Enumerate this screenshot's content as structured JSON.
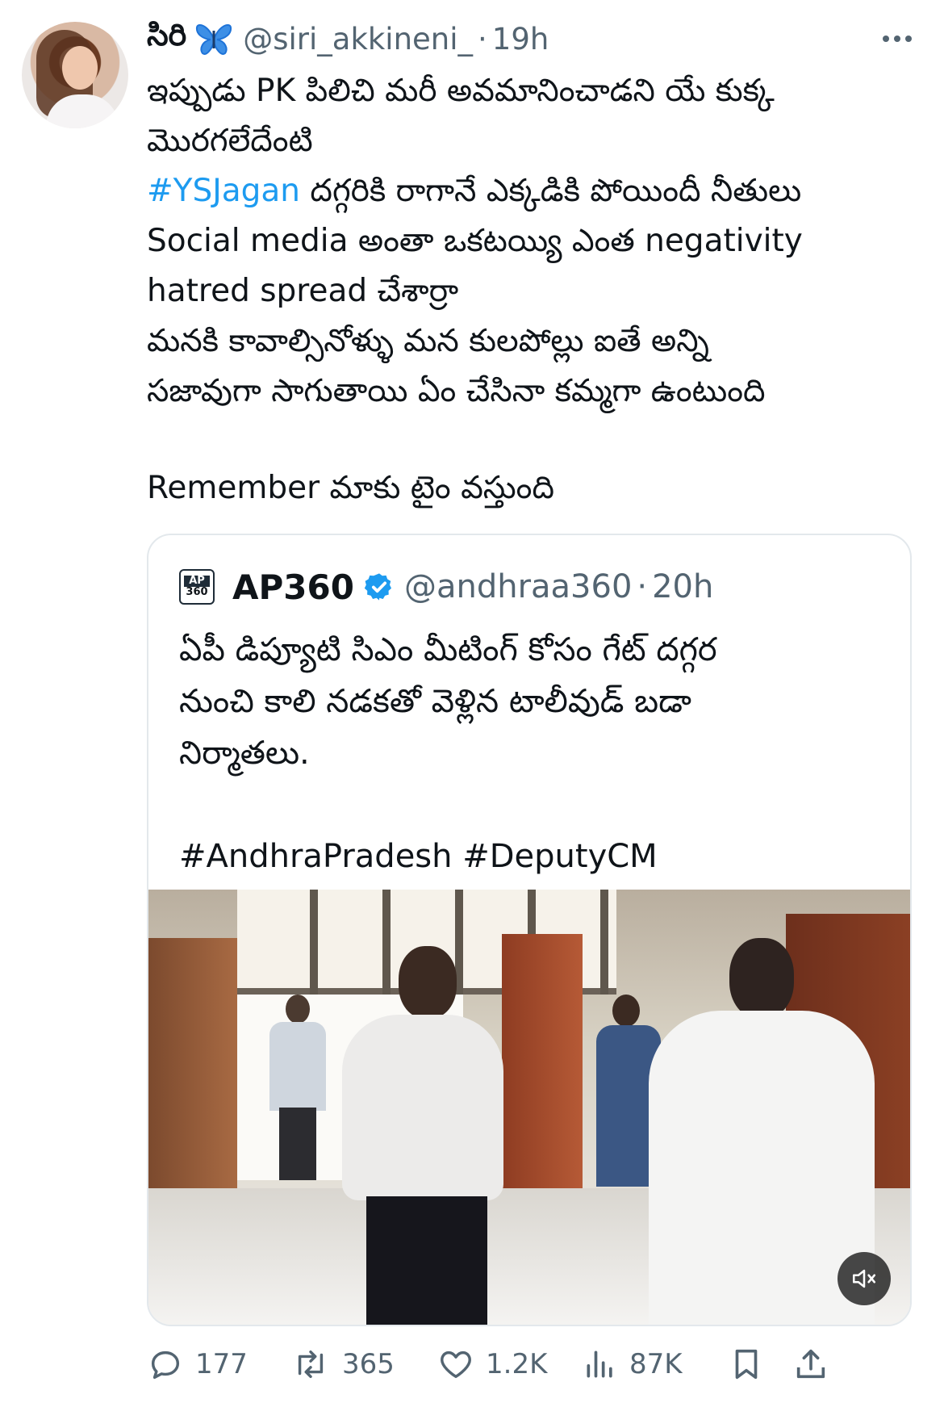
{
  "author": {
    "name": "సిరి",
    "handle": "@siri_akkineni_",
    "dot": "·",
    "time": "19h"
  },
  "body": {
    "line1": "ఇప్పుడు PK పిలిచి మరీ అవమానించాడని యే కుక్క",
    "line2": "మొరగలేదేంటి",
    "line3_hashtag": "#YSJagan",
    "line3_rest": " దగ్గరికి రాగానే ఎక్కడికి పోయిందీ నీతులు",
    "line4": "Social media అంతా ఒకటయ్యి ఎంత negativity",
    "line5": "hatred spread చేశార్రా",
    "line6": "మనకి కావాల్సినోళ్ళు మన కులపోల్లు ఐతే అన్ని",
    "line7": "సజావుగా సాగుతాయి ఏం చేసినా కమ్మగా ఉంటుంది",
    "line8": "Remember మాకు టైం వస్తుంది"
  },
  "quote": {
    "logo_top": "AP",
    "logo_bottom": "360",
    "name": "AP360",
    "handle": "@andhraa360",
    "dot": "·",
    "time": "20h",
    "line1": "ఏపీ డిప్యూటి సిఎం మీటింగ్ కోసం గేట్ దగ్గర",
    "line2": "నుంచి కాలి నడకతో వెళ్లిన టాలీవుడ్ బడా",
    "line3": "నిర్మాతలు.",
    "hashtags": "#AndhraPradesh #DeputyCM"
  },
  "actions": {
    "replies": "177",
    "reposts": "365",
    "likes": "1.2K",
    "views": "87K"
  },
  "colors": {
    "link": "#1d9bf0",
    "secondary_text": "#536471",
    "verified": "#1d9bf0",
    "butterfly": "#1e73d8"
  },
  "icons": [
    "butterfly-emoji",
    "more-icon",
    "verified-badge-icon",
    "mute-icon",
    "reply-icon",
    "repost-icon",
    "like-icon",
    "views-icon",
    "bookmark-icon",
    "share-icon"
  ]
}
